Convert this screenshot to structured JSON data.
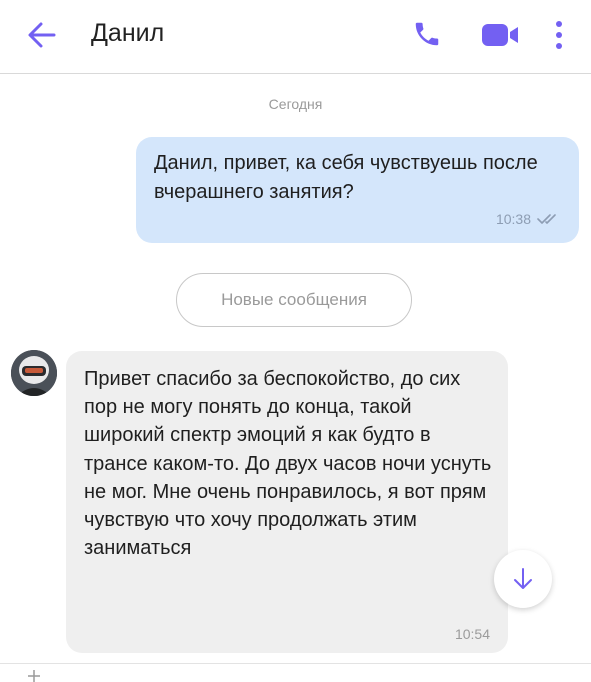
{
  "header": {
    "contact_name": "Данил",
    "icons": {
      "back": "arrow-left-icon",
      "call": "phone-icon",
      "video": "video-camera-icon",
      "more": "more-vertical-icon"
    }
  },
  "colors": {
    "accent": "#7360f2",
    "outgoing_bubble": "#d4e6fb",
    "incoming_bubble": "#efefef"
  },
  "chat": {
    "date_separator": "Сегодня",
    "messages": [
      {
        "direction": "outgoing",
        "text": "Данил, привет, ка себя чувствуешь после вчерашнего занятия?",
        "time": "10:38",
        "status_icon": "double-check-icon"
      },
      {
        "direction": "incoming",
        "text": "Привет спасибо за беспокойство, до сих пор не могу понять до конца, такой широкий спектр эмоций я как будто в трансе каком-то. До двух часов ночи уснуть не мог. Мне очень понравилось, я вот прям чувствую что хочу продолжать этим заниматься",
        "time": "10:54"
      }
    ],
    "new_messages_label": "Новые сообщения"
  },
  "scroll_down_icon": "arrow-down-icon"
}
